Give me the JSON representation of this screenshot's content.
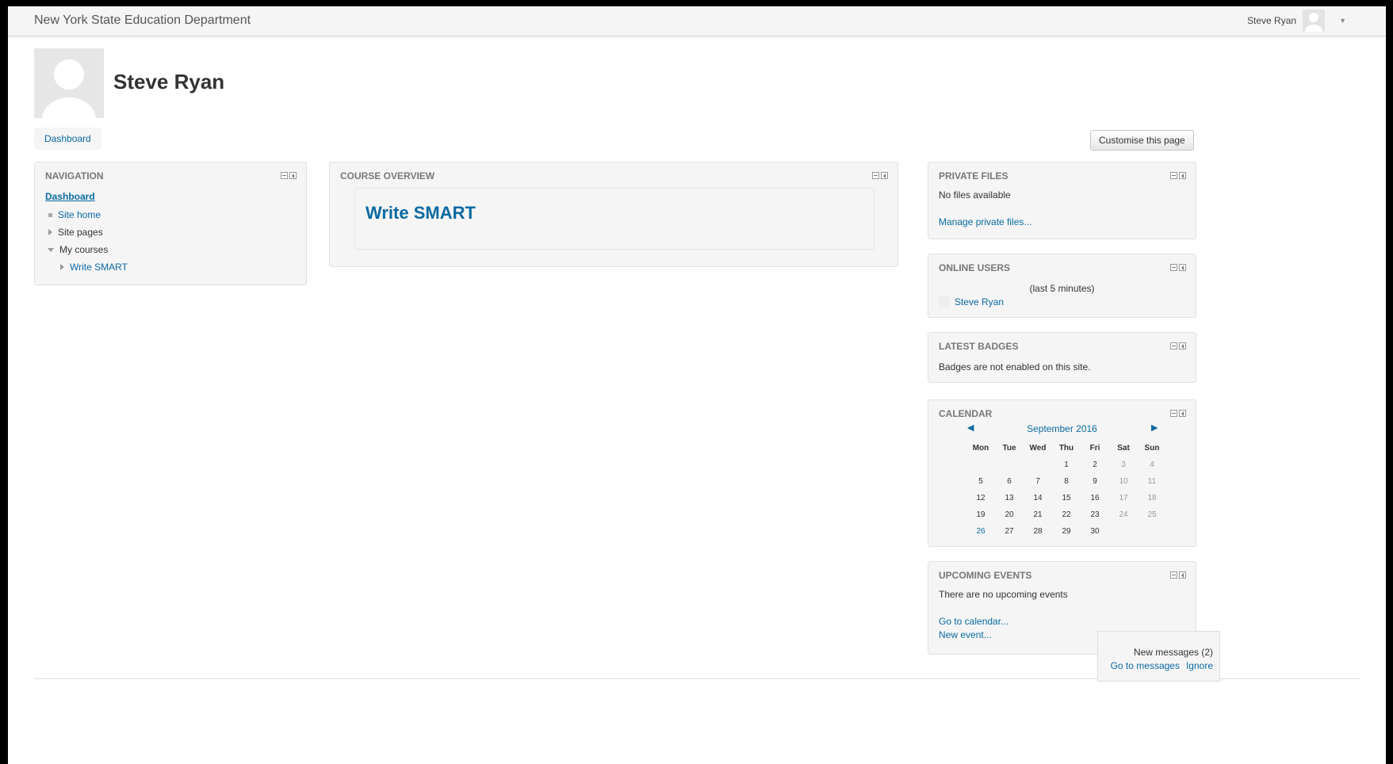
{
  "topbar": {
    "brand": "New York State Education Department",
    "user_name": "Steve Ryan"
  },
  "profile": {
    "name": "Steve Ryan"
  },
  "breadcrumb": {
    "dashboard": "Dashboard"
  },
  "customise_button": "Customise this page",
  "navigation": {
    "title": "NAVIGATION",
    "dashboard": "Dashboard",
    "items": [
      {
        "label": "Site home"
      },
      {
        "label": "Site pages"
      },
      {
        "label": "My courses"
      },
      {
        "label": "Write SMART"
      }
    ]
  },
  "course_overview": {
    "title": "COURSE OVERVIEW",
    "course": "Write SMART"
  },
  "private_files": {
    "title": "PRIVATE FILES",
    "empty": "No files available",
    "manage_link": "Manage private files..."
  },
  "online_users": {
    "title": "ONLINE USERS",
    "subtitle": "(last 5 minutes)",
    "users": [
      "Steve Ryan"
    ]
  },
  "latest_badges": {
    "title": "LATEST BADGES",
    "message": "Badges are not enabled on this site."
  },
  "calendar": {
    "title": "CALENDAR",
    "month": "September 2016",
    "days": [
      "Mon",
      "Tue",
      "Wed",
      "Thu",
      "Fri",
      "Sat",
      "Sun"
    ],
    "weeks": [
      [
        "",
        "",
        "",
        "1",
        "2",
        "3",
        "4"
      ],
      [
        "5",
        "6",
        "7",
        "8",
        "9",
        "10",
        "11"
      ],
      [
        "12",
        "13",
        "14",
        "15",
        "16",
        "17",
        "18"
      ],
      [
        "19",
        "20",
        "21",
        "22",
        "23",
        "24",
        "25"
      ],
      [
        "26",
        "27",
        "28",
        "29",
        "30",
        "",
        ""
      ]
    ],
    "today": "26",
    "prev_icon": "left-arrow-icon",
    "next_icon": "right-arrow-icon"
  },
  "upcoming_events": {
    "title": "UPCOMING EVENTS",
    "message": "There are no upcoming events",
    "goto_calendar": "Go to calendar...",
    "new_event": "New event..."
  },
  "messages_popup": {
    "text": "New messages (2)",
    "goto": "Go to messages",
    "ignore": "Ignore"
  },
  "colors": {
    "link": "#0a6aa1",
    "block_bg": "#f5f5f5",
    "title_gray": "#777777"
  }
}
